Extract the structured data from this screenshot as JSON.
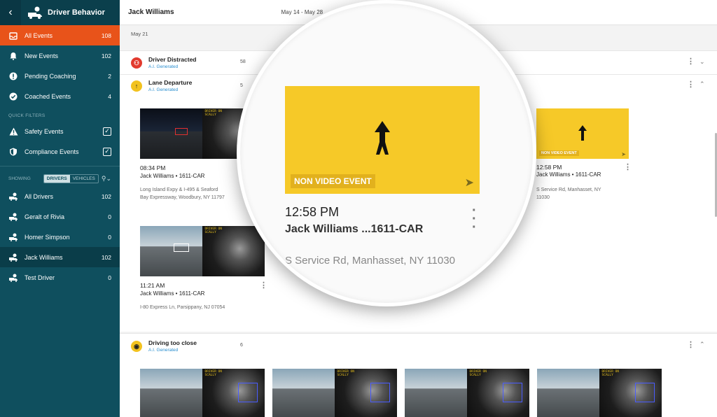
{
  "sidebar": {
    "title": "Driver Behavior",
    "items": [
      {
        "label": "All Events",
        "count": "108"
      },
      {
        "label": "New Events",
        "count": "102"
      },
      {
        "label": "Pending Coaching",
        "count": "2"
      },
      {
        "label": "Coached Events",
        "count": "4"
      }
    ],
    "quick_filters_label": "QUICK FILTERS",
    "filters": [
      {
        "label": "Safety Events",
        "checked": "✓"
      },
      {
        "label": "Compliance Events",
        "checked": "✓"
      }
    ],
    "showing_label": "SHOWING",
    "toggle_drivers": "DRIVERS",
    "toggle_vehicles": "VEHICLES",
    "drivers": [
      {
        "label": "All Drivers",
        "count": "102"
      },
      {
        "label": "Geralt of Rivia",
        "count": "0"
      },
      {
        "label": "Homer Simpson",
        "count": "0"
      },
      {
        "label": "Jack Williams",
        "count": "102"
      },
      {
        "label": "Test Driver",
        "count": "0"
      }
    ]
  },
  "header": {
    "driver": "Jack Williams",
    "date_range": "May 14 - May 28"
  },
  "date_label": "May 21",
  "groups": {
    "distracted": {
      "title": "Driver Distracted",
      "sub": "A.I. Generated",
      "count": "58"
    },
    "lane": {
      "title": "Lane Departure",
      "sub": "A.I. Generated",
      "count": "5"
    },
    "close": {
      "title": "Driving too close",
      "sub": "A.I. Generated",
      "count": "6"
    }
  },
  "lane_events": [
    {
      "time": "08:34 PM",
      "vehicle": "Jack Williams • 1611-CAR",
      "loc1": "Long Island Expy & I-495 & Seaford",
      "loc2": "Bay Expressway, Woodbury, NY 11797"
    },
    {
      "time": "11:21 AM",
      "vehicle": "Jack Williams • 1611-CAR",
      "loc1": "I-80 Express Ln, Parsippany, NJ 07054",
      "loc2": ""
    },
    {
      "time": "12:58 PM",
      "vehicle": "Jack Williams • 1611-CAR",
      "loc1": "S Service Rd, Manhasset, NY",
      "loc2": "11030"
    }
  ],
  "cab_tag": "DRIVER ON\nSCALLY",
  "nve_label": "NON VIDEO EVENT",
  "lens": {
    "label": "NON VIDEO EVENT",
    "time": "12:58 PM",
    "vehicle": "Jack Williams ...1611-CAR",
    "loc": "S Service Rd, Manhasset, NY 11030"
  }
}
